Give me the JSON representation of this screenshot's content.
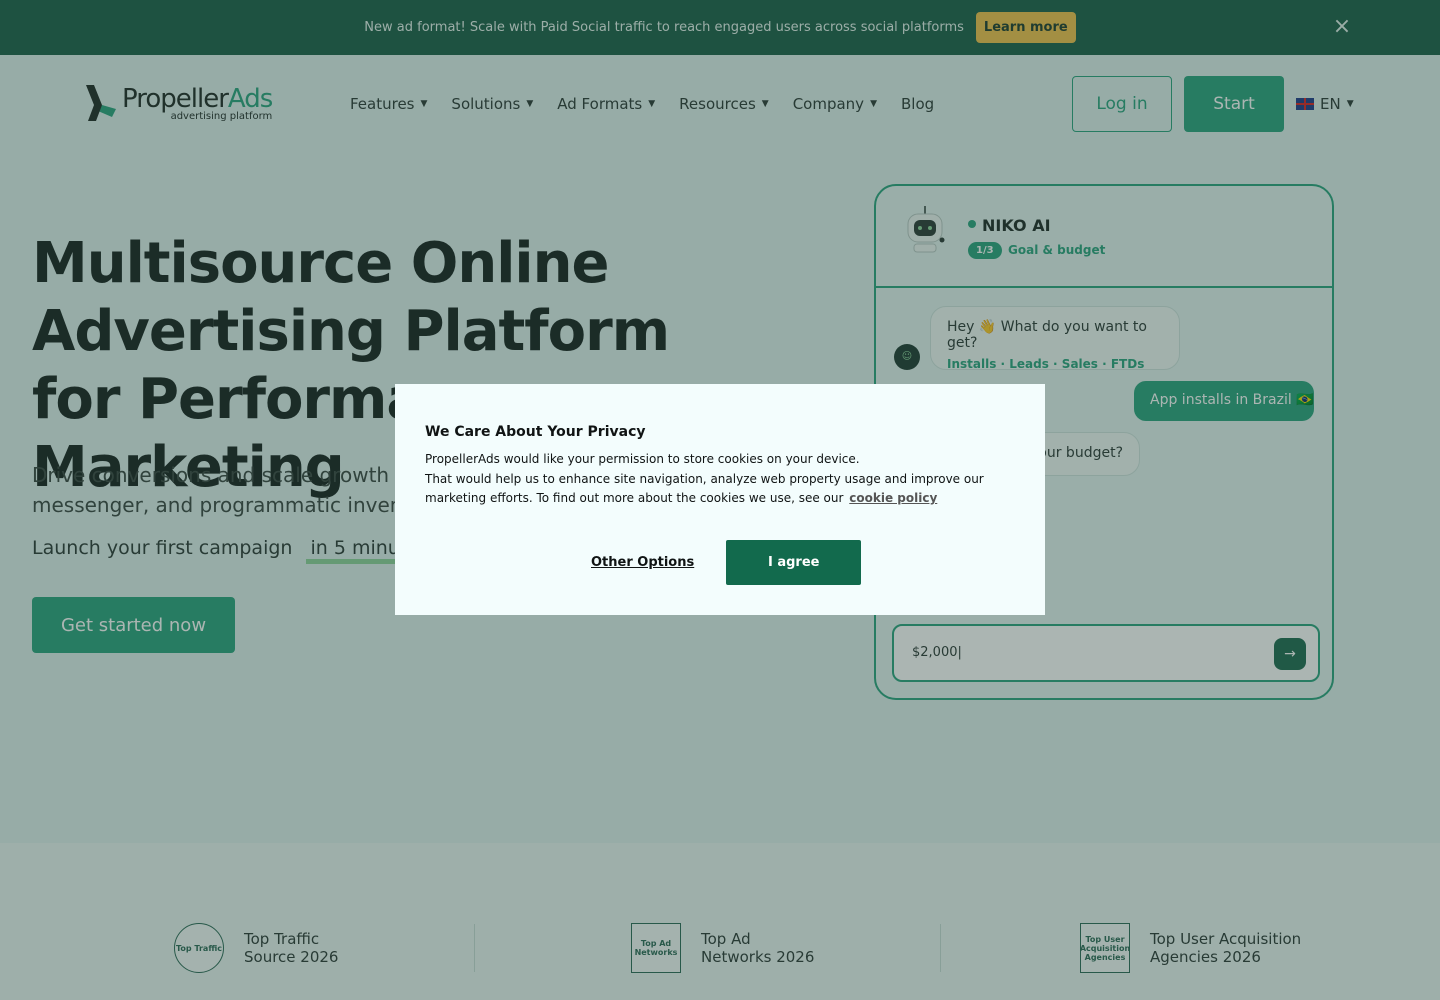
{
  "announcement": {
    "text": "New ad format! Scale with Paid Social traffic to reach engaged users across social platforms",
    "button": "Learn more",
    "close_icon": "close-icon"
  },
  "header": {
    "logo_text": "Propeller",
    "logo_accent": "Ads",
    "logo_sub": "advertising platform",
    "nav": [
      {
        "label": "Features",
        "has_dropdown": true
      },
      {
        "label": "Solutions",
        "has_dropdown": true
      },
      {
        "label": "Ad Formats",
        "has_dropdown": true
      },
      {
        "label": "Resources",
        "has_dropdown": true
      },
      {
        "label": "Company",
        "has_dropdown": true
      },
      {
        "label": "Blog",
        "has_dropdown": false
      }
    ],
    "login": "Log in",
    "start": "Start",
    "language": "EN"
  },
  "hero": {
    "title": "Multisource Online Advertising Platform for Performance Marketing",
    "subtitle": "Drive conversions and scale growth across social, push, native, display, messenger, and programmatic inventory",
    "launch_text": "Launch your first campaign",
    "launch_highlight": "in 5 minutes",
    "cta": "Get started now"
  },
  "chat": {
    "bot_name": "NIKO AI",
    "step_badge": "1/3",
    "step_label": "Goal & budget",
    "message1": "Hey 👋 What do you want to get?",
    "message1_options": "Installs · Leads · Sales · FTDs",
    "user_message": "App installs in Brazil 🇧🇷",
    "message2": "What's your budget?",
    "input_value": "$2,000|"
  },
  "awards": [
    {
      "line1": "Top Traffic",
      "line2": "Source 2026",
      "icon": "Top Traffic"
    },
    {
      "line1": "Top Ad",
      "line2": "Networks 2026",
      "icon": "Top Ad Networks"
    },
    {
      "line1": "Top User Acquisition",
      "line2": "Agencies 2026",
      "icon": "Top User Acquisition Agencies"
    }
  ],
  "cookie_modal": {
    "title": "We Care About Your Privacy",
    "line1": "PropellerAds would like your permission to store cookies on your device.",
    "line2": "That would help us to enhance site navigation, analyze web property usage and improve our marketing efforts. To find out more about the cookies we use, see our",
    "link": "cookie policy",
    "other_options": "Other Options",
    "agree": "I agree"
  },
  "colors": {
    "brand_green": "#2aa37e",
    "topbar": "#1c5f49",
    "learn_more": "#f3c24d",
    "agree": "#126a4d"
  }
}
